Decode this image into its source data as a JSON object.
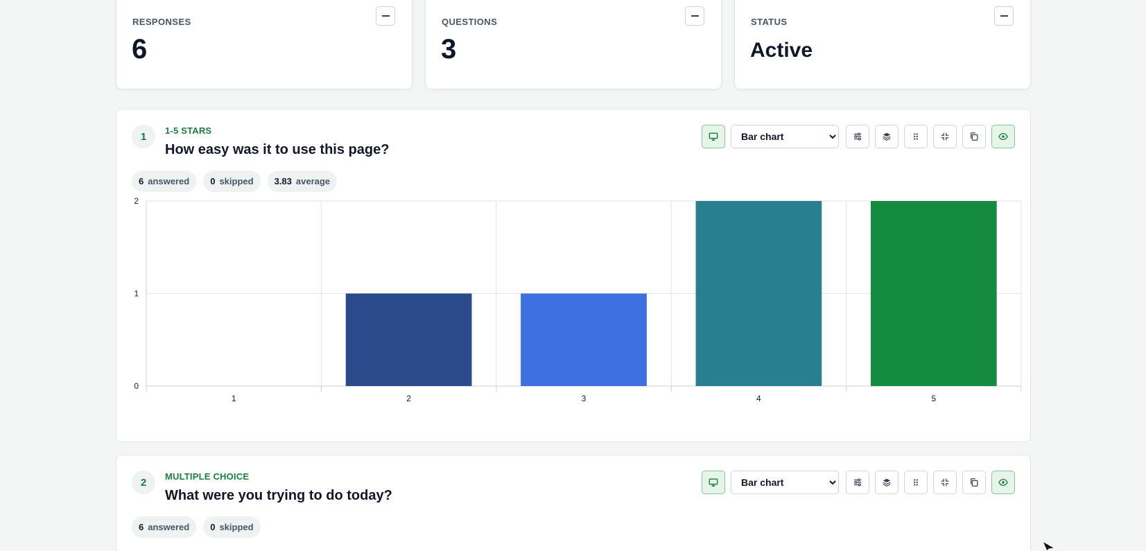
{
  "stats": [
    {
      "label": "RESPONSES",
      "value": "6"
    },
    {
      "label": "QUESTIONS",
      "value": "3"
    },
    {
      "label": "STATUS",
      "value": "Active"
    }
  ],
  "questions": [
    {
      "number": "1",
      "type": "1-5 STARS",
      "title": "How easy was it to use this page?",
      "chart_type": "Bar chart",
      "answered": "6",
      "answered_label": "answered",
      "skipped": "0",
      "skipped_label": "skipped",
      "average": "3.83",
      "average_label": "average"
    },
    {
      "number": "2",
      "type": "MULTIPLE CHOICE",
      "title": "What were you trying to do today?",
      "chart_type": "Bar chart",
      "answered": "6",
      "answered_label": "answered",
      "skipped": "0",
      "skipped_label": "skipped"
    }
  ],
  "chart_select_options": [
    "Bar chart"
  ],
  "icons": {
    "collapse": "minus-icon",
    "toolbar": [
      "monitor-icon",
      "sliders-icon",
      "layers-icon",
      "grip-icon",
      "minimize-icon",
      "copy-icon",
      "eye-icon"
    ]
  },
  "colors": {
    "accent": "#15803d"
  },
  "chart_data": {
    "type": "bar",
    "categories": [
      "1",
      "2",
      "3",
      "4",
      "5"
    ],
    "values": [
      0,
      1,
      1,
      2,
      2
    ],
    "colors": [
      "#2b4a8c",
      "#2b4a8c",
      "#3e70e2",
      "#287f8f",
      "#158b3f"
    ],
    "ylim": [
      0,
      2
    ],
    "yticks": [
      "0",
      "1",
      "2"
    ],
    "grid": true,
    "title": "",
    "xlabel": "",
    "ylabel": ""
  }
}
